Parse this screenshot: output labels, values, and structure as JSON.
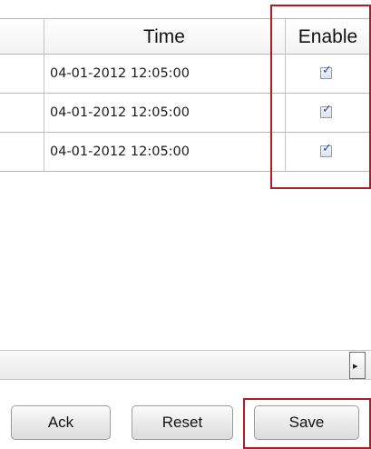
{
  "table": {
    "columns": [
      {
        "label": "Time"
      },
      {
        "label": "Enable"
      }
    ],
    "rows": [
      {
        "time": "04-01-2012 12:05:00",
        "enabled": true
      },
      {
        "time": "04-01-2012 12:05:00",
        "enabled": true
      },
      {
        "time": "04-01-2012 12:05:00",
        "enabled": true
      }
    ]
  },
  "scrollbar": {
    "right_arrow": "▸"
  },
  "buttons": {
    "ack": "Ack",
    "reset": "Reset",
    "save": "Save"
  },
  "checkmark": "✓",
  "colors": {
    "highlight": "#b01c25",
    "checkmark": "#2a4fb8"
  }
}
